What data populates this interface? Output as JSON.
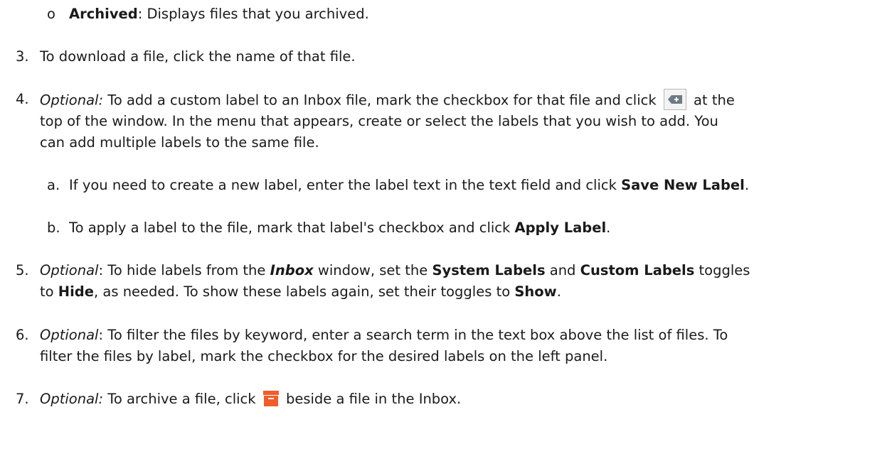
{
  "item_archived": {
    "bullet": "o",
    "term": "Archived",
    "desc": ": Displays files that you archived."
  },
  "step3": {
    "num": "3.",
    "text": "To download a file, click the name of that file."
  },
  "step4": {
    "num": "4.",
    "opt": "Optional:",
    "l1_a": " To add a custom label to an Inbox file, mark the checkbox for that file and click ",
    "icon": "label-icon",
    "l1_b": " at the",
    "l2": "top of the window. In the menu that appears, create or select the labels that you wish to add. You",
    "l3": "can add multiple labels to the same file.",
    "a": {
      "marker": "a.",
      "text": "If you need to create a new label, enter the label text in the text field and click ",
      "bold": "Save New Label",
      "end": "."
    },
    "b": {
      "marker": "b.",
      "text": "To apply a label to the file, mark that label's checkbox and click ",
      "bold": "Apply Label",
      "end": "."
    }
  },
  "step5": {
    "num": "5.",
    "opt": "Optional",
    "l1_a": ": To hide labels from the ",
    "inbox": "Inbox",
    "l1_b": " window, set the ",
    "sys": "System Labels",
    "l1_c": " and ",
    "custom": "Custom Labels",
    "l1_d": " toggles",
    "l2_a": "to ",
    "hide": "Hide",
    "l2_b": ", as needed. To show these labels again, set their toggles to ",
    "show": "Show",
    "l2_c": "."
  },
  "step6": {
    "num": "6.",
    "opt": "Optional",
    "l1": ": To filter the files by keyword, enter a search term in the text box above the list of files. To",
    "l2": "filter the files by label, mark the checkbox for the desired labels on the left panel."
  },
  "step7": {
    "num": "7.",
    "opt": "Optional:",
    "text_a": " To archive a file, click ",
    "icon": "archive-icon",
    "text_b": " beside a file in the Inbox."
  },
  "colors": {
    "text": "#1a1a1a",
    "archive_icon": "#f25c2a"
  }
}
